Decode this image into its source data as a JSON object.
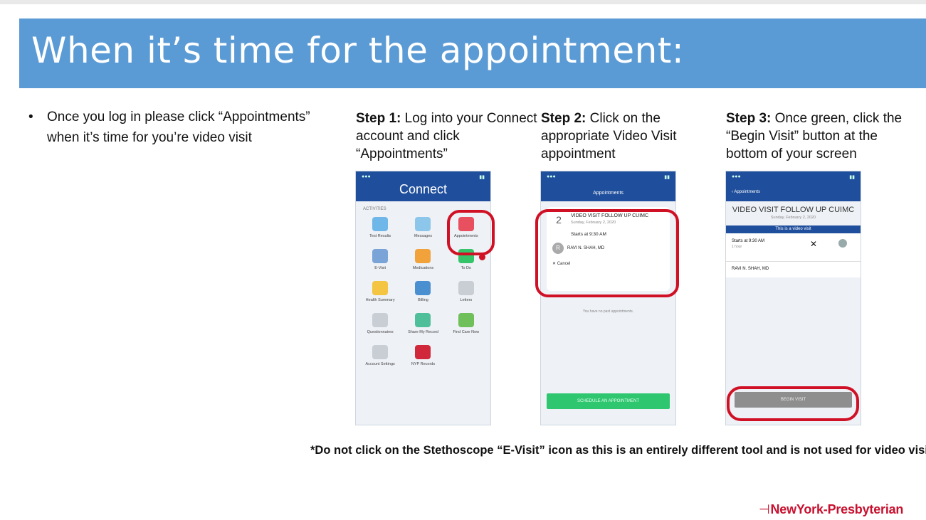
{
  "slide": {
    "title": "When it’s time for the appointment:",
    "bullet": "Once you log in please click “Appointments” when it’s time for you’re video visit",
    "footnote": "*Do not click on the Stethoscope “E-Visit” icon as this is an entirely different tool and is not used for video visits",
    "logo": "NewYork-Presbyterian"
  },
  "steps": [
    {
      "label": "Step 1:",
      "text": " Log into your Connect account and click “Appointments”"
    },
    {
      "label": "Step 2:",
      "text": " Click on the appropriate Video Visit appointment"
    },
    {
      "label": "Step 3:",
      "text": " Once green, click the “Begin Visit” button at the bottom of your screen"
    }
  ],
  "phone1": {
    "header": "Connect",
    "section": "ACTIVITIES",
    "tiles": [
      {
        "label": "Test Results",
        "color": "#6fb7e8"
      },
      {
        "label": "Messages",
        "color": "#8cc6ea"
      },
      {
        "label": "Appointments",
        "color": "#e9505f"
      },
      {
        "label": "E-Visit",
        "color": "#7aa3d8"
      },
      {
        "label": "Medications",
        "color": "#f2a23a"
      },
      {
        "label": "To Do",
        "color": "#35c46a"
      },
      {
        "label": "Health Summary",
        "color": "#f4c542"
      },
      {
        "label": "Billing",
        "color": "#4a8fd0"
      },
      {
        "label": "Letters",
        "color": "#c9cdd4"
      },
      {
        "label": "Questionnaires",
        "color": "#c9cdd4"
      },
      {
        "label": "Share My Record",
        "color": "#4fbf9a"
      },
      {
        "label": "Find Care Now",
        "color": "#6fbf5a"
      },
      {
        "label": "Account Settings",
        "color": "#c9cdd4"
      },
      {
        "label": "NYP Records",
        "color": "#d0283a"
      }
    ]
  },
  "phone2": {
    "header": "Appointments",
    "day": "2",
    "title": "VIDEO VISIT FOLLOW UP CUIMC",
    "date": "Sunday, February 2, 2020",
    "starts": "Starts at 9:30 AM",
    "provider": "RAVI N. SHAH, MD",
    "avatar": "R",
    "cancel": "Cancel",
    "note": "You have no past appointments.",
    "button": "SCHEDULE AN APPOINTMENT"
  },
  "phone3": {
    "back": "Appointments",
    "title": "VIDEO VISIT FOLLOW UP CUIMC",
    "date": "Sunday, February 2, 2020",
    "band": "This is a video visit",
    "starts": "Starts at 9:30 AM",
    "duration": "1 hour",
    "provider": "RAVI N. SHAH, MD",
    "button": "BEGIN VISIT"
  },
  "colors": {
    "accent": "#5b9bd5",
    "highlight": "#d01025",
    "brand": "#c8102e"
  }
}
